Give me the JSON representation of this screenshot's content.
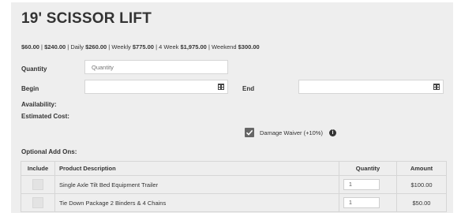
{
  "product": {
    "title": "19' SCISSOR LIFT"
  },
  "pricing": {
    "base": "$60.00",
    "sep1": " | ",
    "base2": "$240.00",
    "sep2": " | Daily ",
    "daily": "$260.00",
    "sep3": " | Weekly ",
    "weekly": "$775.00",
    "sep4": " | 4 Week ",
    "four_week": "$1,975.00",
    "sep5": " | Weekend ",
    "weekend": "$300.00"
  },
  "form": {
    "quantity_label": "Quantity",
    "quantity_placeholder": "Quantity",
    "begin_label": "Begin",
    "end_label": "End",
    "availability_label": "Availability:",
    "estimated_cost_label": "Estimated Cost:",
    "damage_waiver_label": "Damage Waiver (+10%)",
    "damage_waiver_checked": true
  },
  "addons": {
    "heading": "Optional Add Ons:",
    "columns": [
      "Include",
      "Product Description",
      "Quantity",
      "Amount"
    ],
    "rows": [
      {
        "description": "Single Axle Tilt Bed Equipment Trailer",
        "quantity": "1",
        "amount": "$100.00"
      },
      {
        "description": "Tie Down Package 2 Binders & 4 Chains",
        "quantity": "1",
        "amount": "$50.00"
      }
    ]
  },
  "icons": {
    "calendar": "calendar-icon",
    "check": "check-icon",
    "info": "info-icon"
  }
}
